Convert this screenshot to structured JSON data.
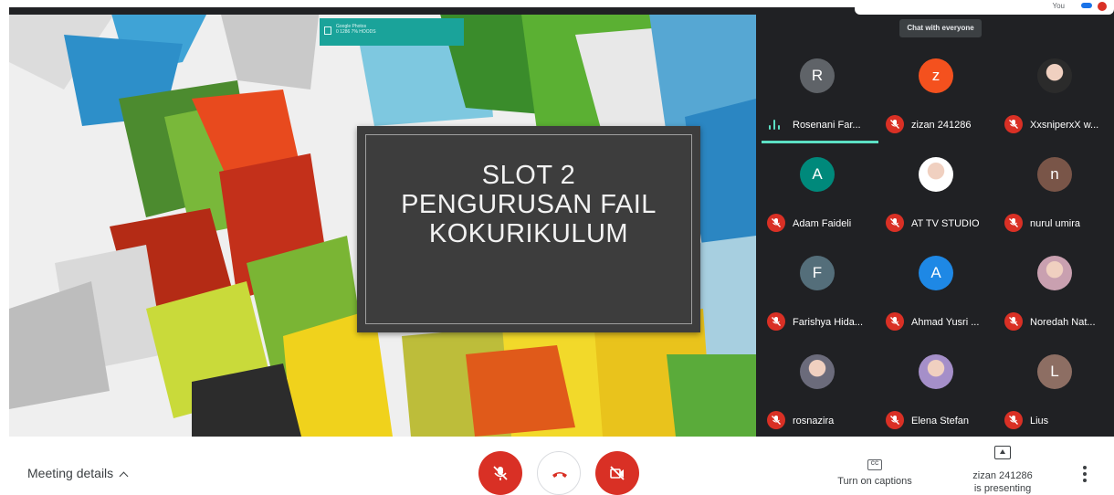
{
  "slide": {
    "title_lines": [
      "SLOT 2",
      "PENGURUSAN FAIL",
      "KOKURIKULUM"
    ],
    "cast_banner_line1": "Google Photos",
    "cast_banner_line2": "0 1286 7% HOODS"
  },
  "top": {
    "you_label": "You",
    "chat_tooltip": "Chat with everyone"
  },
  "participants": [
    {
      "name": "Rosenani Far...",
      "initial": "R",
      "avatar_color": "#5f6368",
      "muted": false,
      "speaking": true
    },
    {
      "name": "zizan 241286",
      "initial": "z",
      "avatar_color": "#f4511e",
      "muted": true
    },
    {
      "name": "XxsniperxX w...",
      "initial": "",
      "avatar_color": "#2b2b2b",
      "muted": true,
      "photo": true
    },
    {
      "name": "Adam Faideli",
      "initial": "A",
      "avatar_color": "#00897b",
      "muted": true
    },
    {
      "name": "AT TV STUDIO",
      "initial": "",
      "avatar_color": "#ffffff",
      "muted": true,
      "photo": true
    },
    {
      "name": "nurul umira",
      "initial": "n",
      "avatar_color": "#795548",
      "muted": true
    },
    {
      "name": "Farishya Hida...",
      "initial": "F",
      "avatar_color": "#546e7a",
      "muted": true
    },
    {
      "name": "Ahmad Yusri ...",
      "initial": "A",
      "avatar_color": "#1e88e5",
      "muted": true
    },
    {
      "name": "Noredah Nat...",
      "initial": "",
      "avatar_color": "#c9a0b0",
      "muted": true,
      "photo": true
    },
    {
      "name": "rosnazira",
      "initial": "",
      "avatar_color": "#6b6b7b",
      "muted": true,
      "photo": true
    },
    {
      "name": "Elena Stefan",
      "initial": "",
      "avatar_color": "#a58fc9",
      "muted": true,
      "photo": true
    },
    {
      "name": "Lius",
      "initial": "L",
      "avatar_color": "#8d6e63",
      "muted": true
    }
  ],
  "bottom": {
    "meeting_details": "Meeting details",
    "captions_label": "Turn on captions",
    "captions_icon": "CC",
    "presenting_line1": "zizan 241286",
    "presenting_line2": "is presenting"
  },
  "colors": {
    "accent": "#5ce0c4",
    "danger": "#d93025",
    "grid_bg": "#202124"
  }
}
